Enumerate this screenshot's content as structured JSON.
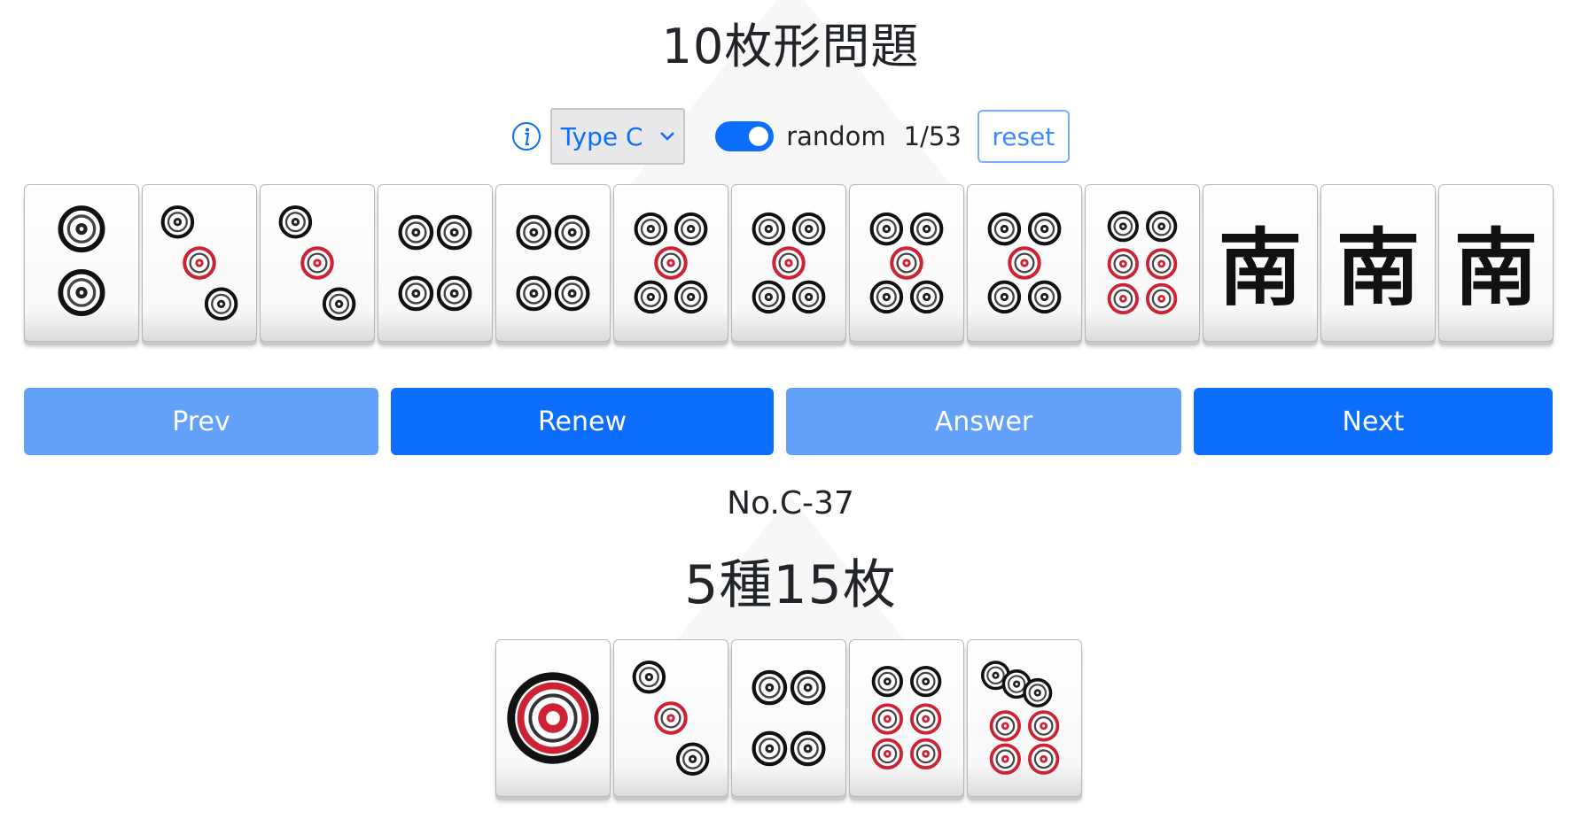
{
  "page": {
    "title": "10枚形問題"
  },
  "controls": {
    "info_icon": "info-icon",
    "type_select": {
      "value": "Type C"
    },
    "random_toggle": {
      "on": true,
      "label": "random"
    },
    "counter": "1/53",
    "reset_label": "reset"
  },
  "hand": {
    "tiles": [
      {
        "suit": "pin",
        "rank": 2
      },
      {
        "suit": "pin",
        "rank": 3
      },
      {
        "suit": "pin",
        "rank": 3
      },
      {
        "suit": "pin",
        "rank": 4
      },
      {
        "suit": "pin",
        "rank": 4
      },
      {
        "suit": "pin",
        "rank": 5
      },
      {
        "suit": "pin",
        "rank": 5
      },
      {
        "suit": "pin",
        "rank": 5
      },
      {
        "suit": "pin",
        "rank": 5
      },
      {
        "suit": "pin",
        "rank": 6
      },
      {
        "suit": "honor",
        "name": "南"
      },
      {
        "suit": "honor",
        "name": "南"
      },
      {
        "suit": "honor",
        "name": "南"
      }
    ]
  },
  "nav": {
    "prev_label": "Prev",
    "renew_label": "Renew",
    "answer_label": "Answer",
    "next_label": "Next"
  },
  "result": {
    "problem_no": "No.C-37",
    "summary": "5種15枚",
    "tiles": [
      {
        "suit": "pin",
        "rank": 1
      },
      {
        "suit": "pin",
        "rank": 3
      },
      {
        "suit": "pin",
        "rank": 4
      },
      {
        "suit": "pin",
        "rank": 6
      },
      {
        "suit": "pin",
        "rank": 7
      }
    ]
  },
  "colors": {
    "accent": "#0d6efd",
    "accent_light": "#63a0fa",
    "pin_red": "#cc2233",
    "ink": "#212529"
  }
}
